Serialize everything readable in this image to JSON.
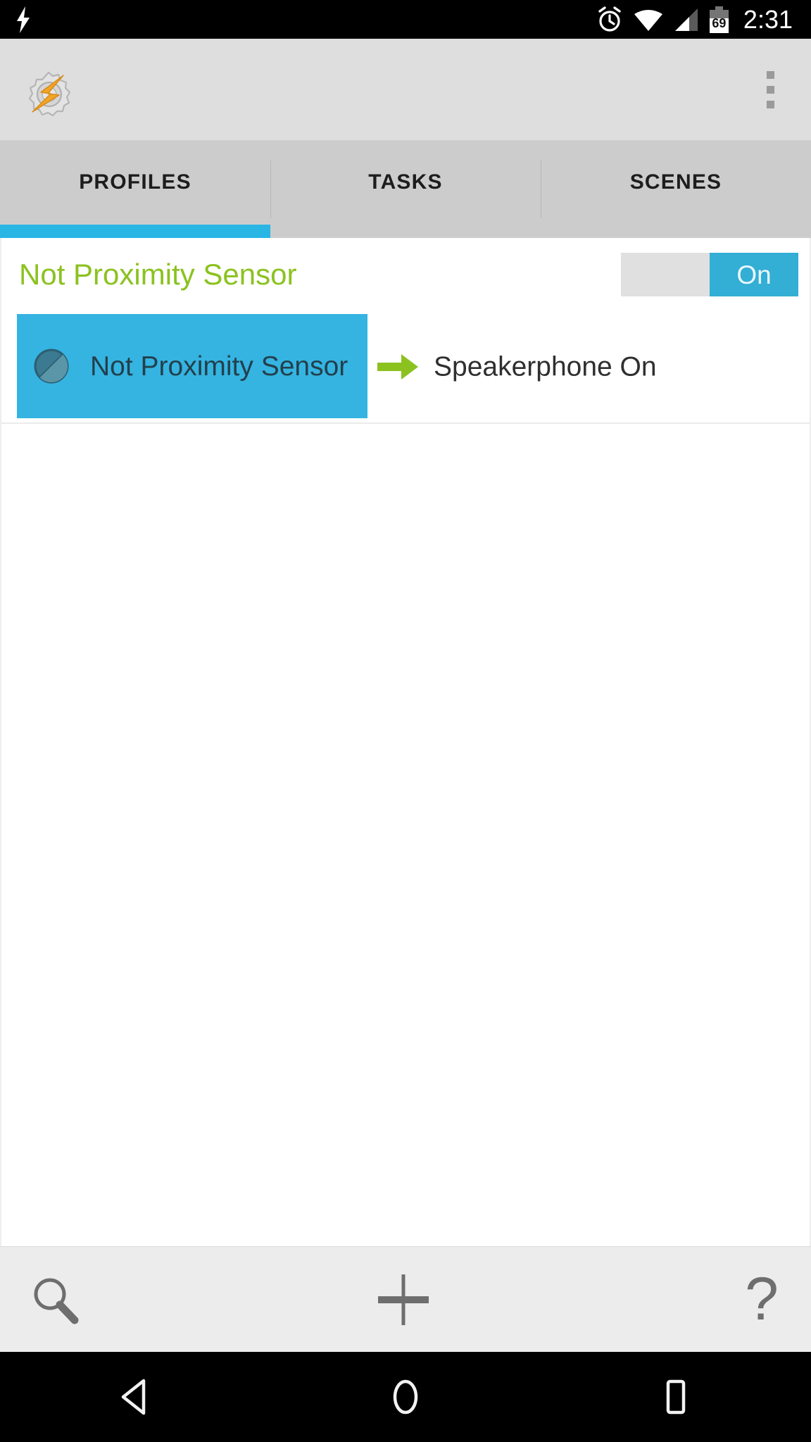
{
  "status_bar": {
    "notification_icon": "lightning-bolt-icon",
    "icons": [
      "alarm-clock-icon",
      "wifi-icon",
      "cell-signal-icon",
      "battery-icon"
    ],
    "battery_level": "69",
    "time": "2:31"
  },
  "app_bar": {
    "app_logo": "tasker-gear-bolt-icon",
    "overflow_menu": "overflow-menu-icon"
  },
  "tabs": {
    "items": [
      {
        "label": "PROFILES",
        "active": true
      },
      {
        "label": "TASKS",
        "active": false
      },
      {
        "label": "SCENES",
        "active": false
      }
    ],
    "active_indicator_color": "#29b6e5"
  },
  "profile": {
    "name": "Not Proximity Sensor",
    "name_color": "#8bc220",
    "enabled_label": "On",
    "context": {
      "icon": "not-circle-slash-icon",
      "label": "Not Proximity Sensor",
      "block_color": "#35b4e2"
    },
    "arrow_icon": "arrow-right-icon",
    "arrow_color": "#8bc220",
    "task": {
      "label": "Speakerphone On"
    }
  },
  "bottom_bar": {
    "buttons": [
      {
        "name": "search",
        "icon": "search-icon"
      },
      {
        "name": "add",
        "icon": "plus-icon"
      },
      {
        "name": "help",
        "icon": "question-mark-icon",
        "glyph": "?"
      }
    ]
  },
  "nav_bar": {
    "buttons": [
      {
        "name": "back",
        "icon": "back-triangle-icon"
      },
      {
        "name": "home",
        "icon": "home-circle-icon"
      },
      {
        "name": "recents",
        "icon": "recents-square-icon"
      }
    ]
  }
}
